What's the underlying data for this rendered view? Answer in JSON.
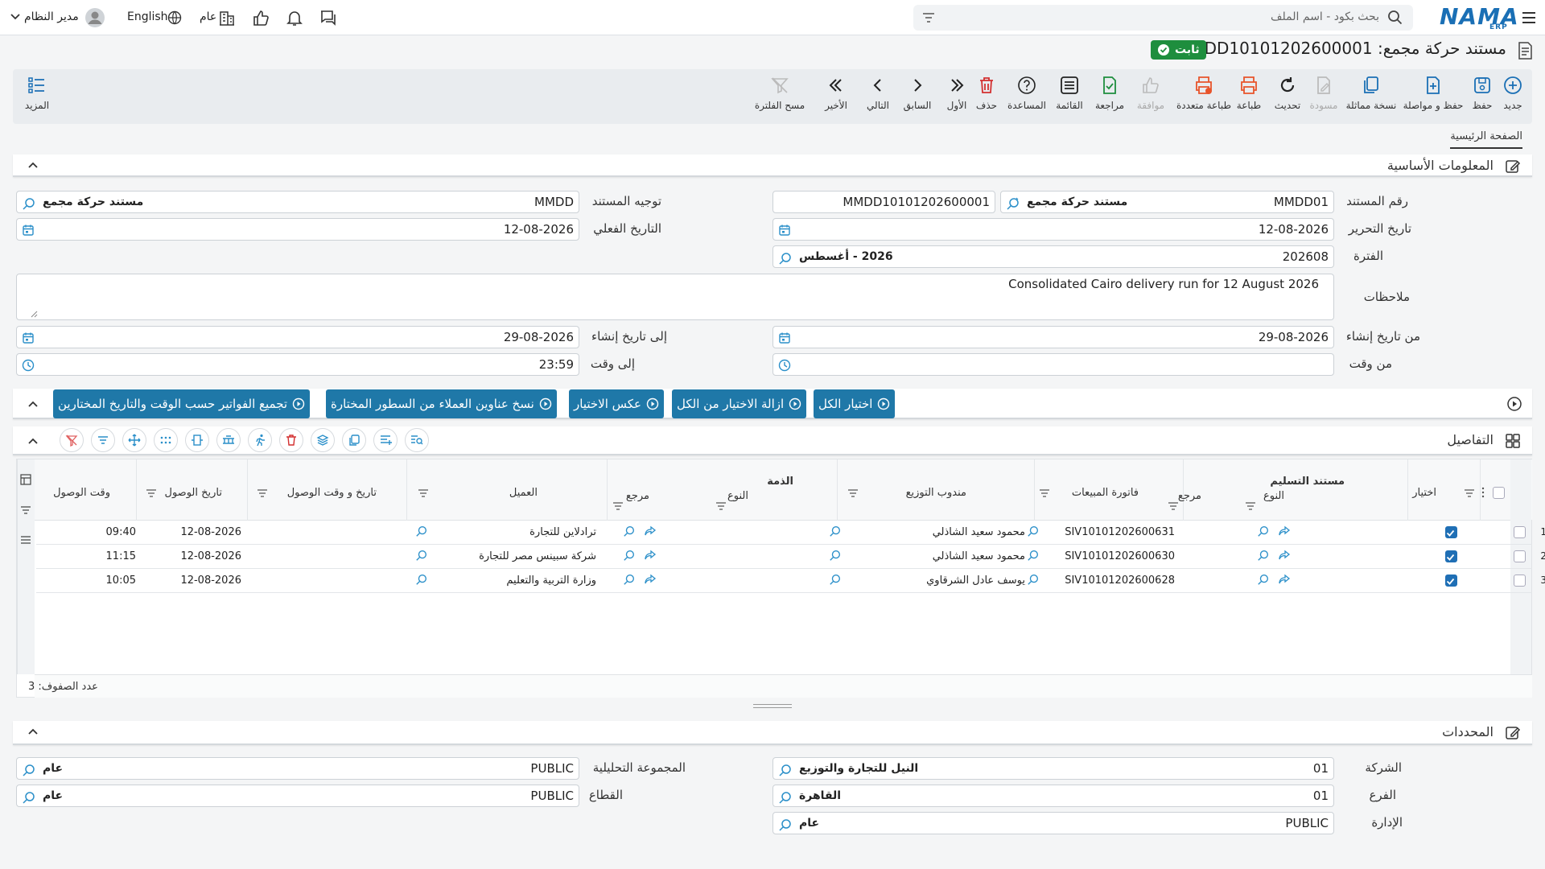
{
  "topbar": {
    "search_placeholder": "بحث بكود - اسم الملف",
    "logo": "NAMA",
    "logo_sub": "ERP",
    "language": "English",
    "scope": "عام",
    "user": "مدير النظام"
  },
  "document": {
    "title": "مستند حركة مجمع: MMDD10101202600001",
    "status": "ثابت"
  },
  "toolbar": {
    "items": [
      "جديد",
      "حفظ",
      "حفظ و مواصلة",
      "نسخة مماثلة",
      "مسودة",
      "تحديث",
      "طباعة",
      "طباعة متعددة",
      "موافقة",
      "مراجعة",
      "القائمة",
      "المساعدة",
      "حذف",
      "الأول",
      "السابق",
      "التالي",
      "الأخير",
      "مسح الفلترة"
    ],
    "more": "المزيد"
  },
  "tabs": {
    "main": "الصفحة الرئيسية"
  },
  "basic_info": {
    "title": "المعلومات الأساسية",
    "doc_number_label": "رقم المستند",
    "doc_number": "MMDD01",
    "doc_type_desc": "مستند حركة مجمع",
    "doc_code": "MMDD10101202600001",
    "direction_label": "توجيه المستند",
    "direction": "MMDD",
    "direction_desc": "مستند حركة مجمع",
    "issue_date_label": "تاريخ التحرير",
    "issue_date": "12-08-2026",
    "actual_date_label": "التاريخ الفعلي",
    "actual_date": "12-08-2026",
    "period_label": "الفترة",
    "period": "202608",
    "period_desc": "2026 - أغسطس",
    "notes_label": "ملاحظات",
    "notes": "Consolidated Cairo delivery run for 12 August 2026",
    "from_create_label": "من تاريخ إنشاء",
    "from_create": "29-08-2026",
    "to_create_label": "إلى تاريخ إنشاء",
    "to_create": "29-08-2026",
    "from_time_label": "من وقت",
    "from_time": "",
    "to_time_label": "إلى وقت",
    "to_time": "23:59"
  },
  "actions": [
    "اختيار الكل",
    "ازالة الاختيار من الكل",
    "عكس الاختيار",
    "نسخ عناوين العملاء من السطور المختارة",
    "تجميع الفواتير حسب الوقت والتاريخ المختارين"
  ],
  "details": {
    "title": "التفاصيل",
    "group_delivery": "مستند التسليم",
    "group_liability": "الذمة",
    "headers": {
      "select": "اختيار",
      "type": "النوع",
      "ref": "مرجع",
      "invoice": "فاتورة المبيعات",
      "rep": "مندوب التوزيع",
      "type2": "النوع",
      "ref2": "مرجع",
      "customer": "العميل",
      "arrival_dt": "تاريخ و وقت الوصول",
      "arrival_date": "تاريخ الوصول",
      "arrival_time": "وقت الوصول"
    },
    "rows": [
      {
        "n": "1",
        "invoice": "SIV10101202600631",
        "rep": "محمود سعيد الشاذلي",
        "customer": "ترادلاين للتجارة",
        "date": "12-08-2026",
        "time": "09:40"
      },
      {
        "n": "2",
        "invoice": "SIV10101202600630",
        "rep": "محمود سعيد الشاذلي",
        "customer": "شركة سبينس مصر للتجارة",
        "date": "12-08-2026",
        "time": "11:15"
      },
      {
        "n": "3",
        "invoice": "SIV10101202600628",
        "rep": "يوسف عادل الشرقاوي",
        "customer": "وزارة التربية والتعليم",
        "date": "12-08-2026",
        "time": "10:05"
      }
    ],
    "row_count": "عدد الصفوف: 3"
  },
  "determinants": {
    "title": "المحددات",
    "company_label": "الشركة",
    "company": "01",
    "company_desc": "النيل للتجارة والتوزيع",
    "branch_label": "الفرع",
    "branch": "01",
    "branch_desc": "القاهرة",
    "dept_label": "الإدارة",
    "dept": "PUBLIC",
    "dept_desc": "عام",
    "analytic_label": "المجموعة التحليلية",
    "analytic": "PUBLIC",
    "analytic_desc": "عام",
    "sector_label": "القطاع",
    "sector": "PUBLIC",
    "sector_desc": "عام"
  },
  "colors": {
    "accent": "#1f78a8",
    "brand": "#1a6fb5",
    "status": "#1e8e3e",
    "delete": "#d32f2f",
    "print": "#e8542b"
  }
}
